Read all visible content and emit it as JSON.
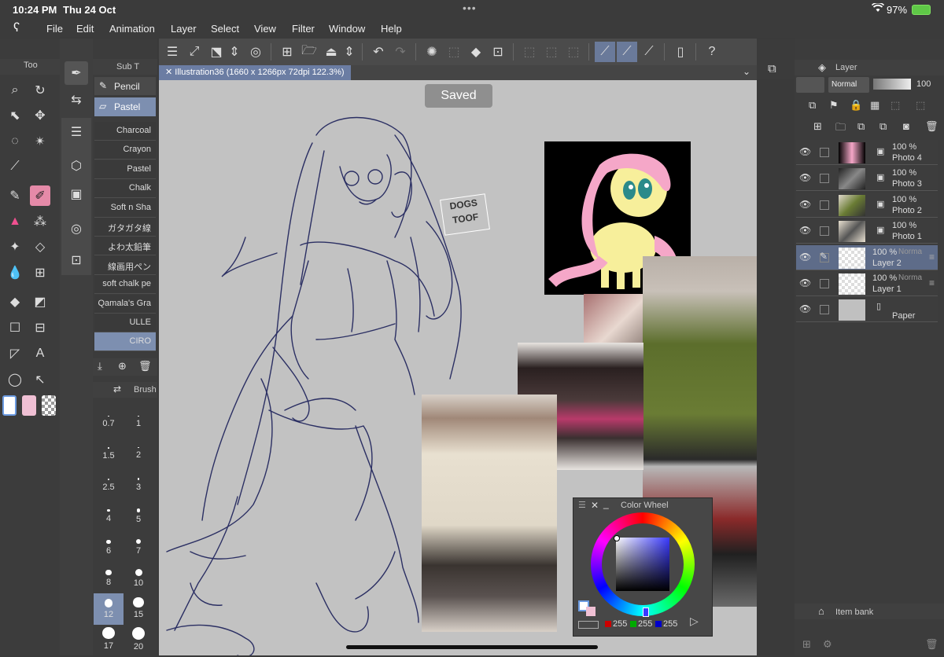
{
  "status": {
    "time": "10:24 PM",
    "date": "Thu 24 Oct",
    "battery": "97%"
  },
  "menu": [
    "File",
    "Edit",
    "Animation",
    "Layer",
    "Select",
    "View",
    "Filter",
    "Window",
    "Help"
  ],
  "tool_panel": {
    "tab": "Too"
  },
  "subtool_panel": {
    "tab": "Sub T",
    "groups": [
      {
        "label": "Pencil",
        "selected": false
      },
      {
        "label": "Pastel",
        "selected": true
      }
    ],
    "brushes": [
      "Charcoal",
      "Crayon",
      "Pastel",
      "Chalk",
      "Soft n Sha",
      "ガタガタ線",
      "よわ太鉛筆",
      "線画用ペン",
      "soft chalk pe",
      "Qamala's Gra",
      "ULLE",
      "CIRO"
    ]
  },
  "brush_size_panel": {
    "tab": "Brush",
    "sizes": [
      "0.7",
      "1",
      "1.5",
      "2",
      "2.5",
      "3",
      "4",
      "5",
      "6",
      "7",
      "8",
      "10",
      "12",
      "15",
      "17",
      "20"
    ],
    "selected": "12"
  },
  "canvas": {
    "tab_label": "Illustration36 (1660 x 1266px 72dpi 122.3%)",
    "toast": "Saved",
    "sticker_text": [
      "DOGS",
      "TOOF"
    ]
  },
  "layer_panel": {
    "tab": "Layer",
    "blend_mode": "Normal",
    "opacity": "100",
    "layers": [
      {
        "opacity": "100 %",
        "name": "Photo 4",
        "mode": "",
        "selected": false
      },
      {
        "opacity": "100 %",
        "name": "Photo 3",
        "mode": "",
        "selected": false
      },
      {
        "opacity": "100 %",
        "name": "Photo 2",
        "mode": "",
        "selected": false
      },
      {
        "opacity": "100 %",
        "name": "Photo 1",
        "mode": "",
        "selected": false
      },
      {
        "opacity": "100 %",
        "name": "Layer 2",
        "mode": "Norma",
        "selected": true
      },
      {
        "opacity": "100 %",
        "name": "Layer 1",
        "mode": "Norma",
        "selected": false
      },
      {
        "opacity": "",
        "name": "Paper",
        "mode": "",
        "selected": false
      }
    ]
  },
  "item_bank": {
    "label": "Item bank"
  },
  "color_wheel": {
    "title": "Color Wheel",
    "r": "255",
    "g": "255",
    "b": "255"
  },
  "colors": {
    "accent": "#6b7da3",
    "pink": "#e58aa8"
  }
}
